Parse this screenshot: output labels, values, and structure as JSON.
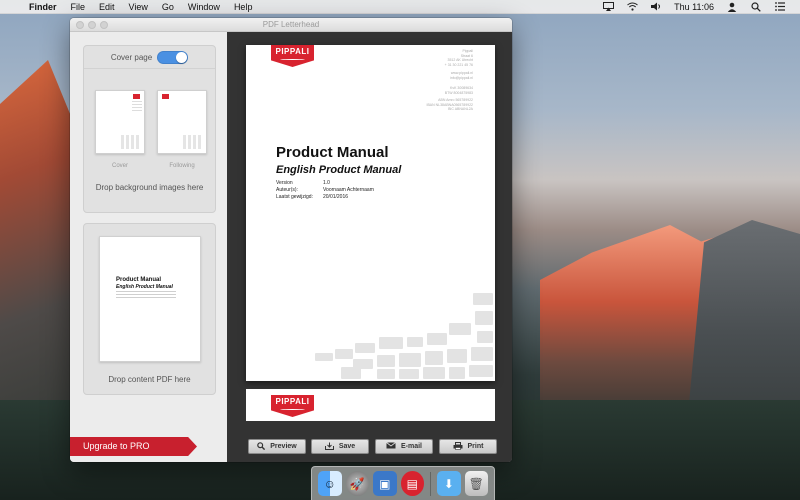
{
  "menubar": {
    "apple_icon": "apple-icon",
    "items": [
      "Finder",
      "File",
      "Edit",
      "View",
      "Go",
      "Window",
      "Help"
    ],
    "clock": "Thu 11:06"
  },
  "window": {
    "title": "PDF Letterhead"
  },
  "sidebar": {
    "cover_page_label": "Cover page",
    "cover_page_enabled": true,
    "thumb_cover_label": "Cover",
    "thumb_following_label": "Following",
    "drop_background_label": "Drop background images here",
    "content_thumb": {
      "title": "Product Manual",
      "subtitle": "English Product Manual"
    },
    "drop_content_label": "Drop content PDF here",
    "upgrade_label": "Upgrade to PRO"
  },
  "document": {
    "logo_text": "PIPPALI",
    "address_1": [
      "Pippali",
      "Straat 6",
      "3512 AK Utrecht",
      "+ 31 30 221 45 76"
    ],
    "address_2": [
      "www.pippali.nl",
      "info@pippali.nl"
    ],
    "address_3": [
      "KvK 30089634",
      "BTW 8004875983"
    ],
    "address_4": [
      "ABN Amro 565789922",
      "IBAN NL38ABNA0565789922",
      "BIC ABNANL2A"
    ],
    "title": "Product Manual",
    "subtitle": "English Product Manual",
    "meta": [
      {
        "key": "Version",
        "value": "1.0"
      },
      {
        "key": "Auteur(s):",
        "value": "Voornaam Achternaam"
      },
      {
        "key": "Laatst gewijzigd:",
        "value": "20/01/2016"
      }
    ]
  },
  "toolbar": {
    "preview_label": "Preview",
    "save_label": "Save",
    "email_label": "E-mail",
    "print_label": "Print"
  },
  "dock": {
    "items": [
      "finder-icon",
      "launchpad-icon",
      "preview-app-icon",
      "pdf-letterhead-icon",
      "downloads-folder-icon",
      "trash-icon"
    ]
  },
  "colors": {
    "accent_red": "#d8232f",
    "toggle_blue": "#4a90e2"
  }
}
